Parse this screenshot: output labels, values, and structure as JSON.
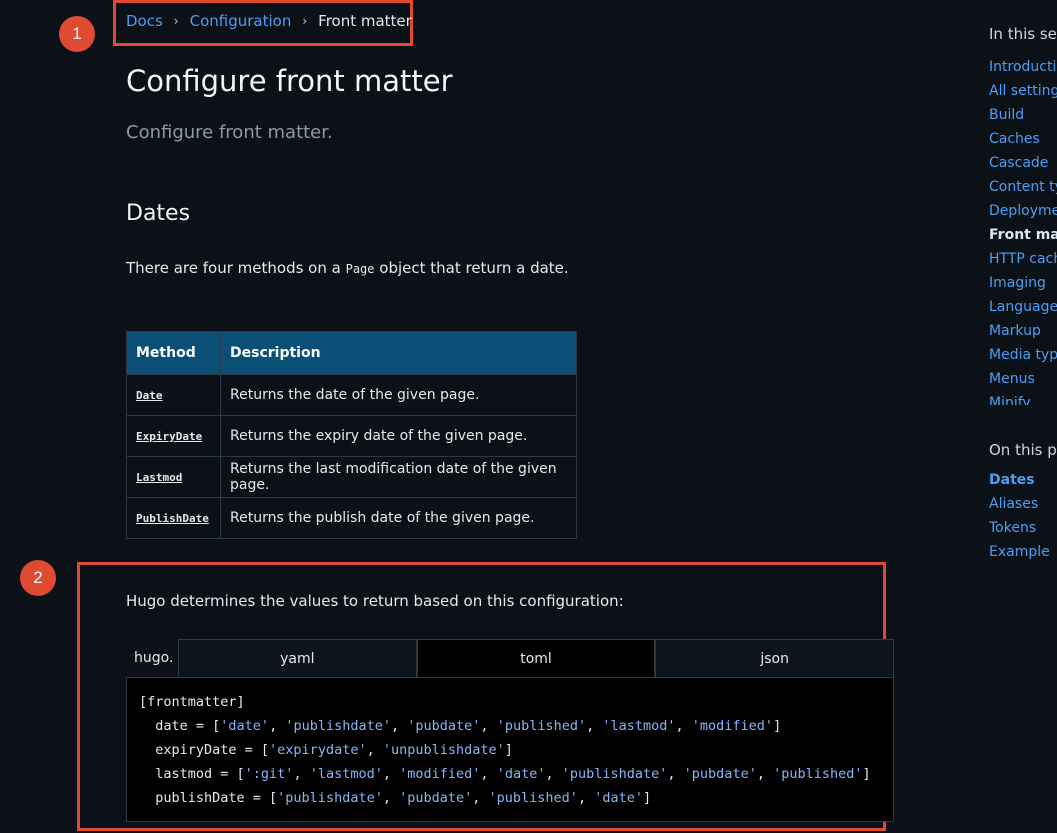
{
  "annotations": {
    "badge1": "1",
    "badge2": "2"
  },
  "breadcrumb": {
    "items": [
      "Docs",
      "Configuration"
    ],
    "current": "Front matter",
    "separator": "›"
  },
  "page": {
    "title": "Configure front matter",
    "subtitle": "Configure front matter.",
    "section_heading": "Dates",
    "intro_before": "There are four methods on a ",
    "intro_code": "Page",
    "intro_after": " object that return a date.",
    "config_text": "Hugo determines the values to return based on this configuration:"
  },
  "table": {
    "headers": [
      "Method",
      "Description"
    ],
    "rows": [
      {
        "method": "Date",
        "description": "Returns the date of the given page."
      },
      {
        "method": "ExpiryDate",
        "description": "Returns the expiry date of the given page."
      },
      {
        "method": "Lastmod",
        "description": "Returns the last modification date of the given page."
      },
      {
        "method": "PublishDate",
        "description": "Returns the publish date of the given page."
      }
    ]
  },
  "code_tabs": {
    "prefix": "hugo.",
    "tabs": [
      "yaml",
      "toml",
      "json"
    ],
    "active": "toml"
  },
  "code": {
    "line0": "[frontmatter]",
    "date_key": "  date = [",
    "date_vals": [
      "'date'",
      "'publishdate'",
      "'pubdate'",
      "'published'",
      "'lastmod'",
      "'modified'"
    ],
    "expiry_key": "  expiryDate = [",
    "expiry_vals": [
      "'expirydate'",
      "'unpublishdate'"
    ],
    "lastmod_key": "  lastmod = [",
    "lastmod_vals": [
      "':git'",
      "'lastmod'",
      "'modified'",
      "'date'",
      "'publishdate'",
      "'pubdate'",
      "'published'"
    ],
    "publish_key": "  publishDate = [",
    "publish_vals": [
      "'publishdate'",
      "'pubdate'",
      "'published'",
      "'date'"
    ]
  },
  "sidebar": {
    "section_heading": "In this sec",
    "section_items": [
      "Introductic",
      "All settings",
      "Build",
      "Caches",
      "Cascade",
      "Content ty",
      "Deploymen",
      "Front matt",
      "HTTP cach",
      "Imaging",
      "Languages",
      "Markup",
      "Media type",
      "Menus",
      "Minify"
    ],
    "section_active": "Front matt",
    "page_heading": "On this pa",
    "page_items": [
      "Dates",
      "Aliases",
      "Tokens",
      "Example"
    ],
    "page_active": "Dates"
  }
}
